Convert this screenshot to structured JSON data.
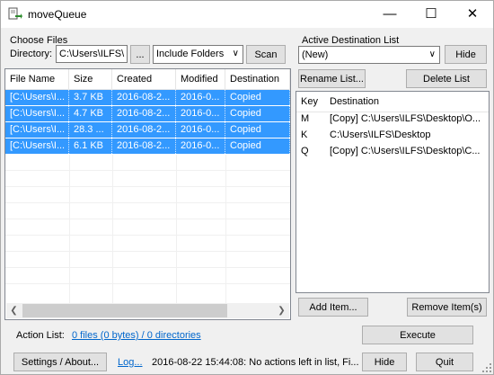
{
  "window": {
    "title": "moveQueue",
    "minimize": "—",
    "maximize": "☐",
    "close": "✕"
  },
  "choose_files": {
    "group_label": "Choose Files",
    "directory_label": "Directory:",
    "directory_value": "C:\\Users\\ILFS\\",
    "browse_label": "...",
    "include_option": "Include Folders",
    "scan_label": "Scan"
  },
  "file_table": {
    "columns": [
      "File Name",
      "Size",
      "Created",
      "Modified",
      "Destination"
    ],
    "rows": [
      [
        "[C:\\Users\\I...",
        "3.7 KB",
        "2016-08-2...",
        "2016-0...",
        "Copied"
      ],
      [
        "[C:\\Users\\I...",
        "4.7 KB",
        "2016-08-2...",
        "2016-0...",
        "Copied"
      ],
      [
        "[C:\\Users\\I...",
        "28.3 ...",
        "2016-08-2...",
        "2016-0...",
        "Copied"
      ],
      [
        "[C:\\Users\\I...",
        "6.1 KB",
        "2016-08-2...",
        "2016-0...",
        "Copied"
      ]
    ]
  },
  "destination": {
    "group_label": "Active Destination List",
    "selected_list": "(New)",
    "hide_label": "Hide",
    "rename_label": "Rename List...",
    "delete_label": "Delete List",
    "columns": [
      "Key",
      "Destination"
    ],
    "items": [
      {
        "key": "M",
        "dest": "[Copy] C:\\Users\\ILFS\\Desktop\\O..."
      },
      {
        "key": "K",
        "dest": "C:\\Users\\ILFS\\Desktop"
      },
      {
        "key": "Q",
        "dest": "[Copy] C:\\Users\\ILFS\\Desktop\\C..."
      }
    ],
    "add_label": "Add Item...",
    "remove_label": "Remove Item(s)"
  },
  "action_list": {
    "label": "Action List:",
    "summary_link": "0 files (0 bytes) / 0 directories",
    "execute_label": "Execute"
  },
  "footer": {
    "settings_label": "Settings / About...",
    "log_link": "Log...",
    "status": "2016-08-22 15:44:08: No actions left in list, Fi...",
    "hide_label": "Hide",
    "quit_label": "Quit"
  },
  "colors": {
    "selection": "#3399ff",
    "link": "#0066cc",
    "background": "#f0f0f0"
  }
}
